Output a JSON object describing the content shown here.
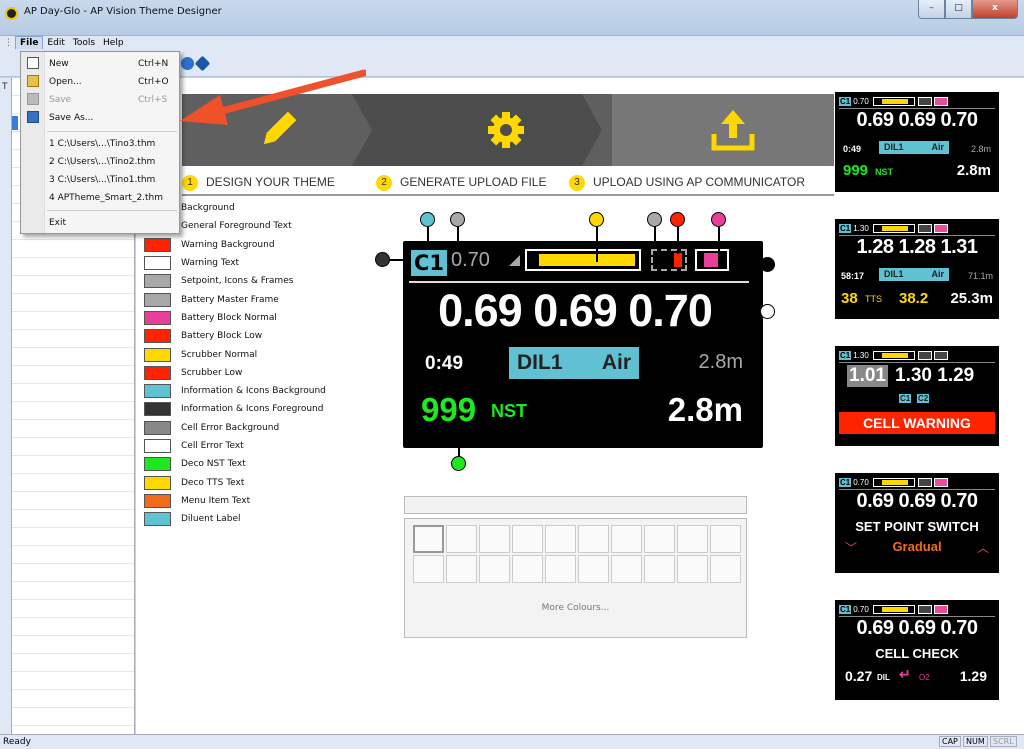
{
  "window": {
    "title": "AP Day-Glo - AP Vision Theme Designer",
    "min": "–",
    "max": "□",
    "close": "x"
  },
  "menu": {
    "file": "File",
    "edit": "Edit",
    "tools": "Tools",
    "help": "Help"
  },
  "file_menu": {
    "new": {
      "label": "New",
      "shortcut": "Ctrl+N"
    },
    "open": {
      "label": "Open...",
      "shortcut": "Ctrl+O"
    },
    "save": {
      "label": "Save",
      "shortcut": "Ctrl+S"
    },
    "save_as": {
      "label": "Save As..."
    },
    "recent": [
      "1 C:\\Users\\...\\Tino3.thm",
      "2 C:\\Users\\...\\Tino2.thm",
      "3 C:\\Users\\...\\Tino1.thm",
      "4 APTheme_Smart_2.thm"
    ],
    "exit": "Exit"
  },
  "steps": [
    {
      "num": "1",
      "label": "DESIGN YOUR THEME"
    },
    {
      "num": "2",
      "label": "GENERATE UPLOAD FILE"
    },
    {
      "num": "3",
      "label": "UPLOAD USING AP COMMUNICATOR"
    }
  ],
  "legend": [
    {
      "label": "Background",
      "color": "#000000"
    },
    {
      "label": "General Foreground Text",
      "color": "#ffffff"
    },
    {
      "label": "Warning Background",
      "color": "#ff2400"
    },
    {
      "label": "Warning Text",
      "color": "#ffffff"
    },
    {
      "label": "Setpoint, Icons & Frames",
      "color": "#a8a8a8"
    },
    {
      "label": "Battery Master Frame",
      "color": "#a8a8a8"
    },
    {
      "label": "Battery Block Normal",
      "color": "#e8409a"
    },
    {
      "label": "Battery Block Low",
      "color": "#ff2400"
    },
    {
      "label": "Scrubber Normal",
      "color": "#ffd800"
    },
    {
      "label": "Scrubber Low",
      "color": "#ff2400"
    },
    {
      "label": "Information & Icons Background",
      "color": "#5fc1d2"
    },
    {
      "label": "Information & Icons Foreground",
      "color": "#333333"
    },
    {
      "label": "Cell Error Background",
      "color": "#888888"
    },
    {
      "label": "Cell Error Text",
      "color": "#ffffff"
    },
    {
      "label": "Deco NST Text",
      "color": "#1ee81e"
    },
    {
      "label": "Deco TTS Text",
      "color": "#ffd800"
    },
    {
      "label": "Menu Item Text",
      "color": "#f26a1b"
    },
    {
      "label": "Diluent Label",
      "color": "#5fc1d2"
    }
  ],
  "device": {
    "cell_badge": "C1",
    "setpoint": "0.70",
    "ppo2": "0.69 0.69 0.70",
    "time": "0:49",
    "dil": "DIL1",
    "gas": "Air",
    "depth_small": "2.8m",
    "nst": "999",
    "nst_label": "NST",
    "depth": "2.8m"
  },
  "palette": {
    "more": "More Colours..."
  },
  "thumbs": [
    {
      "badge": "C1",
      "sp": "0.70",
      "big": "0.69 0.69 0.70",
      "r1a": "0:49",
      "r1b": "DIL1",
      "r1c": "Air",
      "r1d": "2.8m",
      "r2a": "999",
      "r2b": "NST",
      "r2c": "2.8m"
    },
    {
      "badge": "C1",
      "sp": "1.30",
      "big": "1.28 1.28 1.31",
      "r1a": "58:17",
      "r1b": "DIL1",
      "r1c": "Air",
      "r1d": "71.1m",
      "r2a": "38",
      "r2b": "TTS",
      "r2c": "38.2",
      "r2d": "25.3m"
    },
    {
      "badge": "C1",
      "sp": "1.30",
      "big_a": "1.01",
      "big_b": "1.30 1.29",
      "chips": [
        "C1",
        "C2"
      ],
      "warn": "CELL WARNING"
    },
    {
      "badge": "C1",
      "sp": "0.70",
      "big": "0.69 0.69 0.70",
      "title": "SET POINT SWITCH",
      "value": "Gradual"
    },
    {
      "badge": "C1",
      "sp": "0.70",
      "big": "0.69 0.69 0.70",
      "title": "CELL CHECK",
      "a": "0.27",
      "a_sub": "DIL",
      "b_sub": "O2",
      "b": "1.29"
    }
  ],
  "status": {
    "ready": "Ready",
    "cap": "CAP",
    "num": "NUM",
    "scrl": "SCRL"
  }
}
